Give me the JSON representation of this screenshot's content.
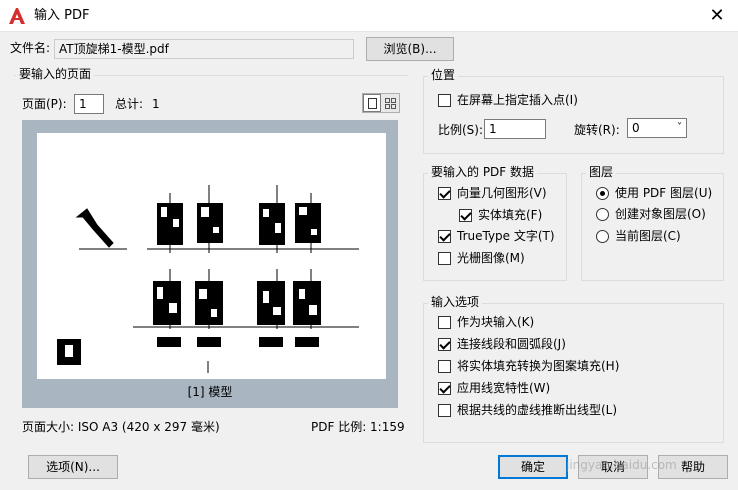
{
  "window": {
    "title": "输入 PDF",
    "close_glyph": "✕"
  },
  "file": {
    "label": "文件名:",
    "value": "AT顶旋梯1-模型.pdf",
    "browse_label": "浏览(B)..."
  },
  "pages": {
    "group_title": "要输入的页面",
    "page_label": "页面(P):",
    "page_value": "1",
    "total_label": "总计:",
    "total_value": "1",
    "preview_caption": "[1] 模型",
    "page_size": "页面大小: ISO A3 (420 x 297 毫米)",
    "pdf_scale": "PDF 比例: 1:159"
  },
  "position": {
    "group_title": "位置",
    "specify_on_screen": {
      "label": "在屏幕上指定插入点(I)",
      "checked": false
    },
    "scale_label": "比例(S):",
    "scale_value": "1",
    "rotation_label": "旋转(R):",
    "rotation_value": "0"
  },
  "pdf_data": {
    "group_title": "要输入的 PDF 数据",
    "items": [
      {
        "label": "向量几何图形(V)",
        "checked": true
      },
      {
        "label": "实体填充(F)",
        "checked": true
      },
      {
        "label": "TrueType 文字(T)",
        "checked": true
      },
      {
        "label": "光栅图像(M)",
        "checked": false
      }
    ]
  },
  "layers": {
    "group_title": "图层",
    "options": [
      {
        "label": "使用 PDF 图层(U)",
        "selected": true
      },
      {
        "label": "创建对象图层(O)",
        "selected": false
      },
      {
        "label": "当前图层(C)",
        "selected": false
      }
    ]
  },
  "import_options": {
    "group_title": "输入选项",
    "items": [
      {
        "label": "作为块输入(K)",
        "checked": false
      },
      {
        "label": "连接线段和圆弧段(J)",
        "checked": true
      },
      {
        "label": "将实体填充转换为图案填充(H)",
        "checked": false
      },
      {
        "label": "应用线宽特性(W)",
        "checked": true
      },
      {
        "label": "根据共线的虚线推断出线型(L)",
        "checked": false
      }
    ]
  },
  "footer": {
    "options_label": "选项(N)...",
    "ok_label": "确定",
    "cancel_label": "取消",
    "help_label": "帮助"
  },
  "watermark": "jingyan.baidu.com",
  "colors": {
    "accent": "#0078d7",
    "preview_bg": "#a9b6c2",
    "app_icon": "#d32f2f"
  }
}
